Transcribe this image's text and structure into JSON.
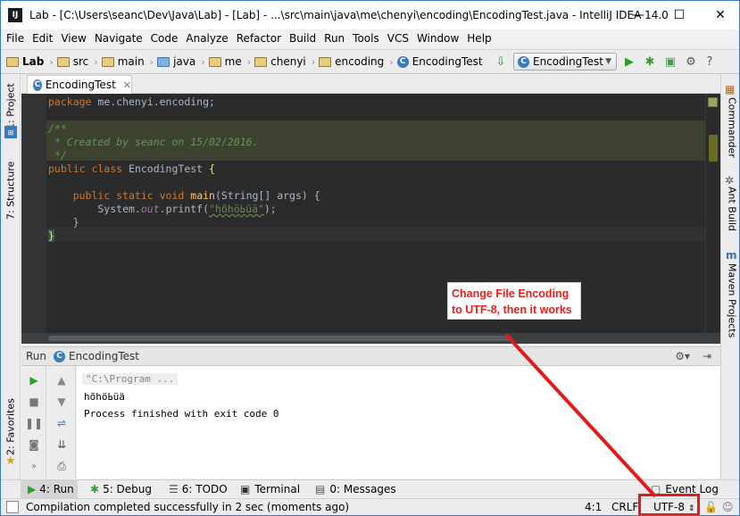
{
  "window": {
    "title": "Lab - [C:\\Users\\seanc\\Dev\\Java\\Lab] - [Lab] - ...\\src\\main\\java\\me\\chenyi\\encoding\\EncodingTest.java - IntelliJ IDEA 14.0",
    "minimize": "—",
    "maximize": "☐",
    "close": "✕",
    "logo": "IJ"
  },
  "menu": [
    "File",
    "Edit",
    "View",
    "Navigate",
    "Code",
    "Analyze",
    "Refactor",
    "Build",
    "Run",
    "Tools",
    "VCS",
    "Window",
    "Help"
  ],
  "breadcrumbs": [
    "Lab",
    "src",
    "main",
    "java",
    "me",
    "chenyi",
    "encoding",
    "EncodingTest"
  ],
  "run_config": "EncodingTest",
  "left_tabs": {
    "project": "1: Project",
    "structure": "7: Structure",
    "favorites": "2: Favorites"
  },
  "right_tabs": {
    "commander": "Commander",
    "ant": "Ant Build",
    "maven": "Maven Projects"
  },
  "editor": {
    "tab": "EncodingTest",
    "code": {
      "pkg_kw": "package",
      "pkg_name": " me.chenyi.encoding;",
      "c1": "/**",
      "c2": " * Created by seanc on 15/02/2016.",
      "c3": " */",
      "cls_kw": "public class",
      "cls_name": " EncodingTest ",
      "cls_brace": "{",
      "m_kw": "    public static void",
      "m_name": "main",
      "m_args": "(String[] args) {",
      "p1": "        System.",
      "p2": "out",
      "p3": ".printf(",
      "p4": "\"hõhöߕüä\"",
      "p5": ");",
      "close1": "    }",
      "close2": "}"
    }
  },
  "run_panel": {
    "label": "Run",
    "tab": "EncodingTest",
    "console": [
      "\"C:\\Program ...",
      "hõhöߕüä",
      "Process finished with exit code 0"
    ]
  },
  "bottom_tabs": [
    "4: Run",
    "5: Debug",
    "6: TODO",
    "Terminal",
    "0: Messages",
    "Event Log"
  ],
  "status": {
    "message": "Compilation completed successfully in 2 sec (moments ago)",
    "position": "4:1",
    "line_sep": "CRLF",
    "encoding": "UTF-8"
  },
  "annotation": "Change File Encoding to UTF-8, then it works",
  "colors": {
    "annotation": "#e21a1a",
    "editor_bg": "#2b2b2b"
  }
}
